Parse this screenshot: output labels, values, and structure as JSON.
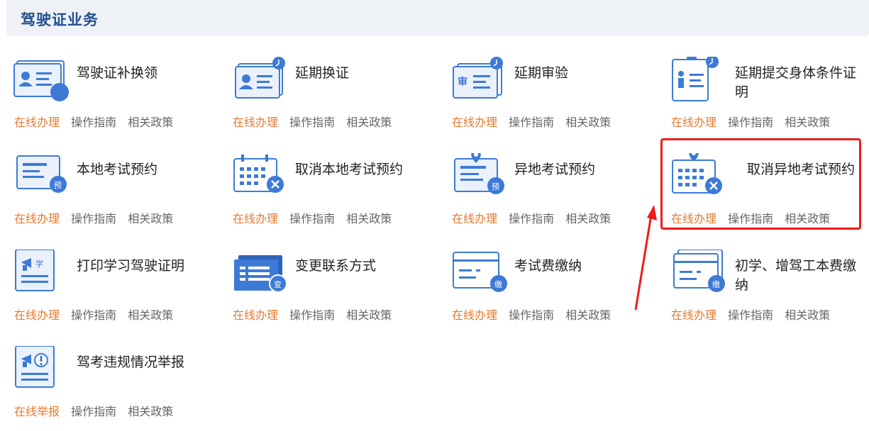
{
  "header": {
    "title": "驾驶证业务"
  },
  "items": [
    {
      "title": "驾驶证补换领",
      "online": "在线办理",
      "guide": "操作指南",
      "policy": "相关政策",
      "icon": "license-clock-icon"
    },
    {
      "title": "延期换证",
      "online": "在线办理",
      "guide": "操作指南",
      "policy": "相关政策",
      "icon": "license-clock-icon"
    },
    {
      "title": "延期审验",
      "online": "在线办理",
      "guide": "操作指南",
      "policy": "相关政策",
      "icon": "review-card-icon"
    },
    {
      "title": "延期提交身体条件证明",
      "online": "在线办理",
      "guide": "操作指南",
      "policy": "相关政策",
      "icon": "health-card-icon"
    },
    {
      "title": "本地考试预约",
      "online": "在线办理",
      "guide": "操作指南",
      "policy": "相关政策",
      "icon": "booking-card-icon"
    },
    {
      "title": "取消本地考试预约",
      "online": "在线办理",
      "guide": "操作指南",
      "policy": "相关政策",
      "icon": "calendar-cancel-icon"
    },
    {
      "title": "异地考试预约",
      "online": "在线办理",
      "guide": "操作指南",
      "policy": "相关政策",
      "icon": "location-booking-icon"
    },
    {
      "title": "取消异地考试预约",
      "online": "在线办理",
      "guide": "操作指南",
      "policy": "相关政策",
      "icon": "location-calendar-cancel-icon"
    },
    {
      "title": "打印学习驾驶证明",
      "online": "在线办理",
      "guide": "操作指南",
      "policy": "相关政策",
      "icon": "learner-clipboard-icon"
    },
    {
      "title": "变更联系方式",
      "online": "在线办理",
      "guide": "操作指南",
      "policy": "相关政策",
      "icon": "contact-change-icon"
    },
    {
      "title": "考试费缴纳",
      "online": "在线办理",
      "guide": "操作指南",
      "policy": "相关政策",
      "icon": "fee-card-icon"
    },
    {
      "title": "初学、增驾工本费缴纳",
      "online": "在线办理",
      "guide": "操作指南",
      "policy": "相关政策",
      "icon": "fee-cards-icon"
    },
    {
      "title": "驾考违规情况举报",
      "online": "在线举报",
      "guide": "操作指南",
      "policy": "相关政策",
      "icon": "report-clipboard-icon"
    }
  ],
  "colors": {
    "accent": "#3d7ad6",
    "online_link": "#e8792f",
    "highlight": "#ee1c1c"
  }
}
